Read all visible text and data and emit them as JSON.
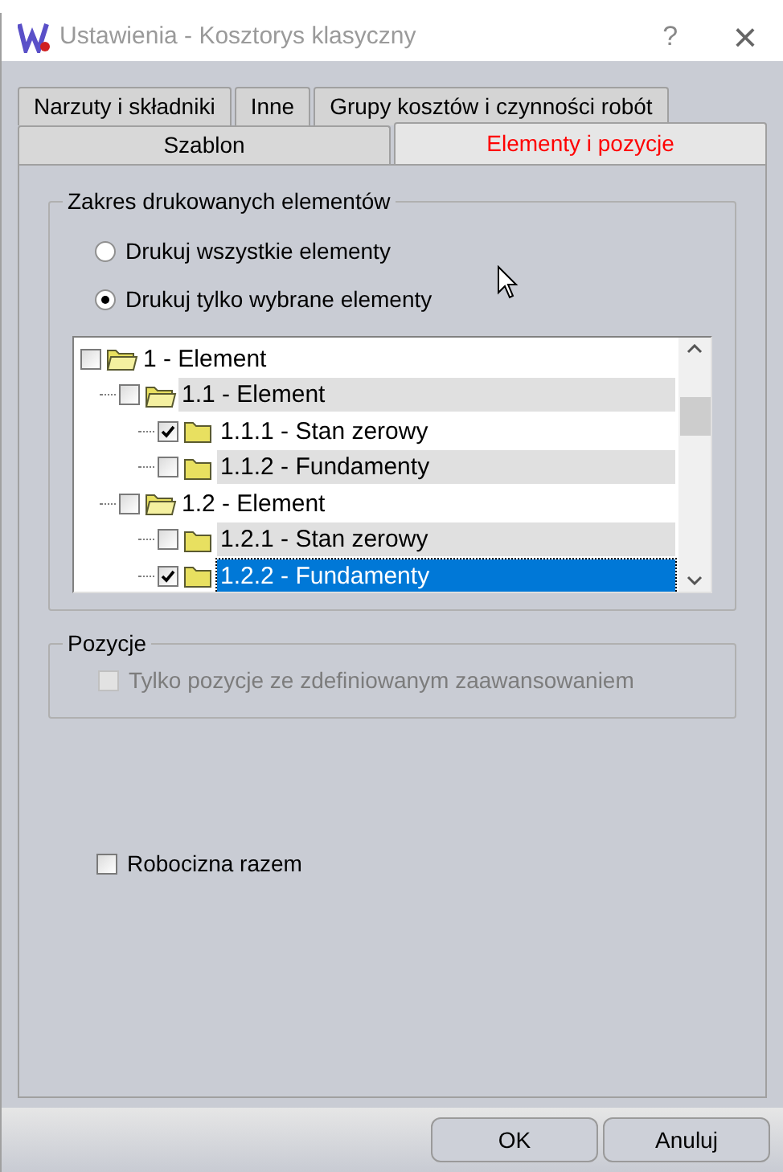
{
  "window": {
    "title": "Ustawienia - Kosztorys klasyczny",
    "help": "?",
    "close": "×"
  },
  "tab_rows": [
    [
      {
        "label": "Narzuty i składniki",
        "selected": false
      },
      {
        "label": "Inne",
        "selected": false
      },
      {
        "label": "Grupy kosztów i czynności robót",
        "selected": false
      }
    ],
    [
      {
        "label": "Szablon",
        "selected": false
      },
      {
        "label": "Elementy i pozycje",
        "selected": true
      }
    ]
  ],
  "range_group": {
    "title": "Zakres drukowanych elementów",
    "options": [
      {
        "label": "Drukuj wszystkie elementy",
        "selected": false
      },
      {
        "label": "Drukuj tylko wybrane elementy",
        "selected": true
      }
    ],
    "tree": [
      {
        "label": "1 - Element",
        "checked": false,
        "shaded": false,
        "selected": false,
        "children": [
          {
            "label": "1.1 - Element",
            "checked": false,
            "shaded": true,
            "selected": false,
            "children": [
              {
                "label": "1.1.1 - Stan zerowy",
                "checked": true,
                "shaded": false,
                "selected": false
              },
              {
                "label": "1.1.2 - Fundamenty",
                "checked": false,
                "shaded": true,
                "selected": false
              }
            ]
          },
          {
            "label": "1.2 - Element",
            "checked": false,
            "shaded": false,
            "selected": false,
            "children": [
              {
                "label": "1.2.1 - Stan zerowy",
                "checked": false,
                "shaded": true,
                "selected": false
              },
              {
                "label": "1.2.2 - Fundamenty",
                "checked": true,
                "shaded": false,
                "selected": true
              }
            ]
          }
        ]
      }
    ]
  },
  "positions_group": {
    "title": "Pozycje",
    "checkbox": {
      "label": "Tylko pozycje ze zdefiniowanym zaawansowaniem",
      "checked": false,
      "disabled": true
    }
  },
  "labor_checkbox": {
    "label": "Robocizna razem",
    "checked": false,
    "disabled": false
  },
  "buttons": [
    "OK",
    "Anuluj"
  ]
}
